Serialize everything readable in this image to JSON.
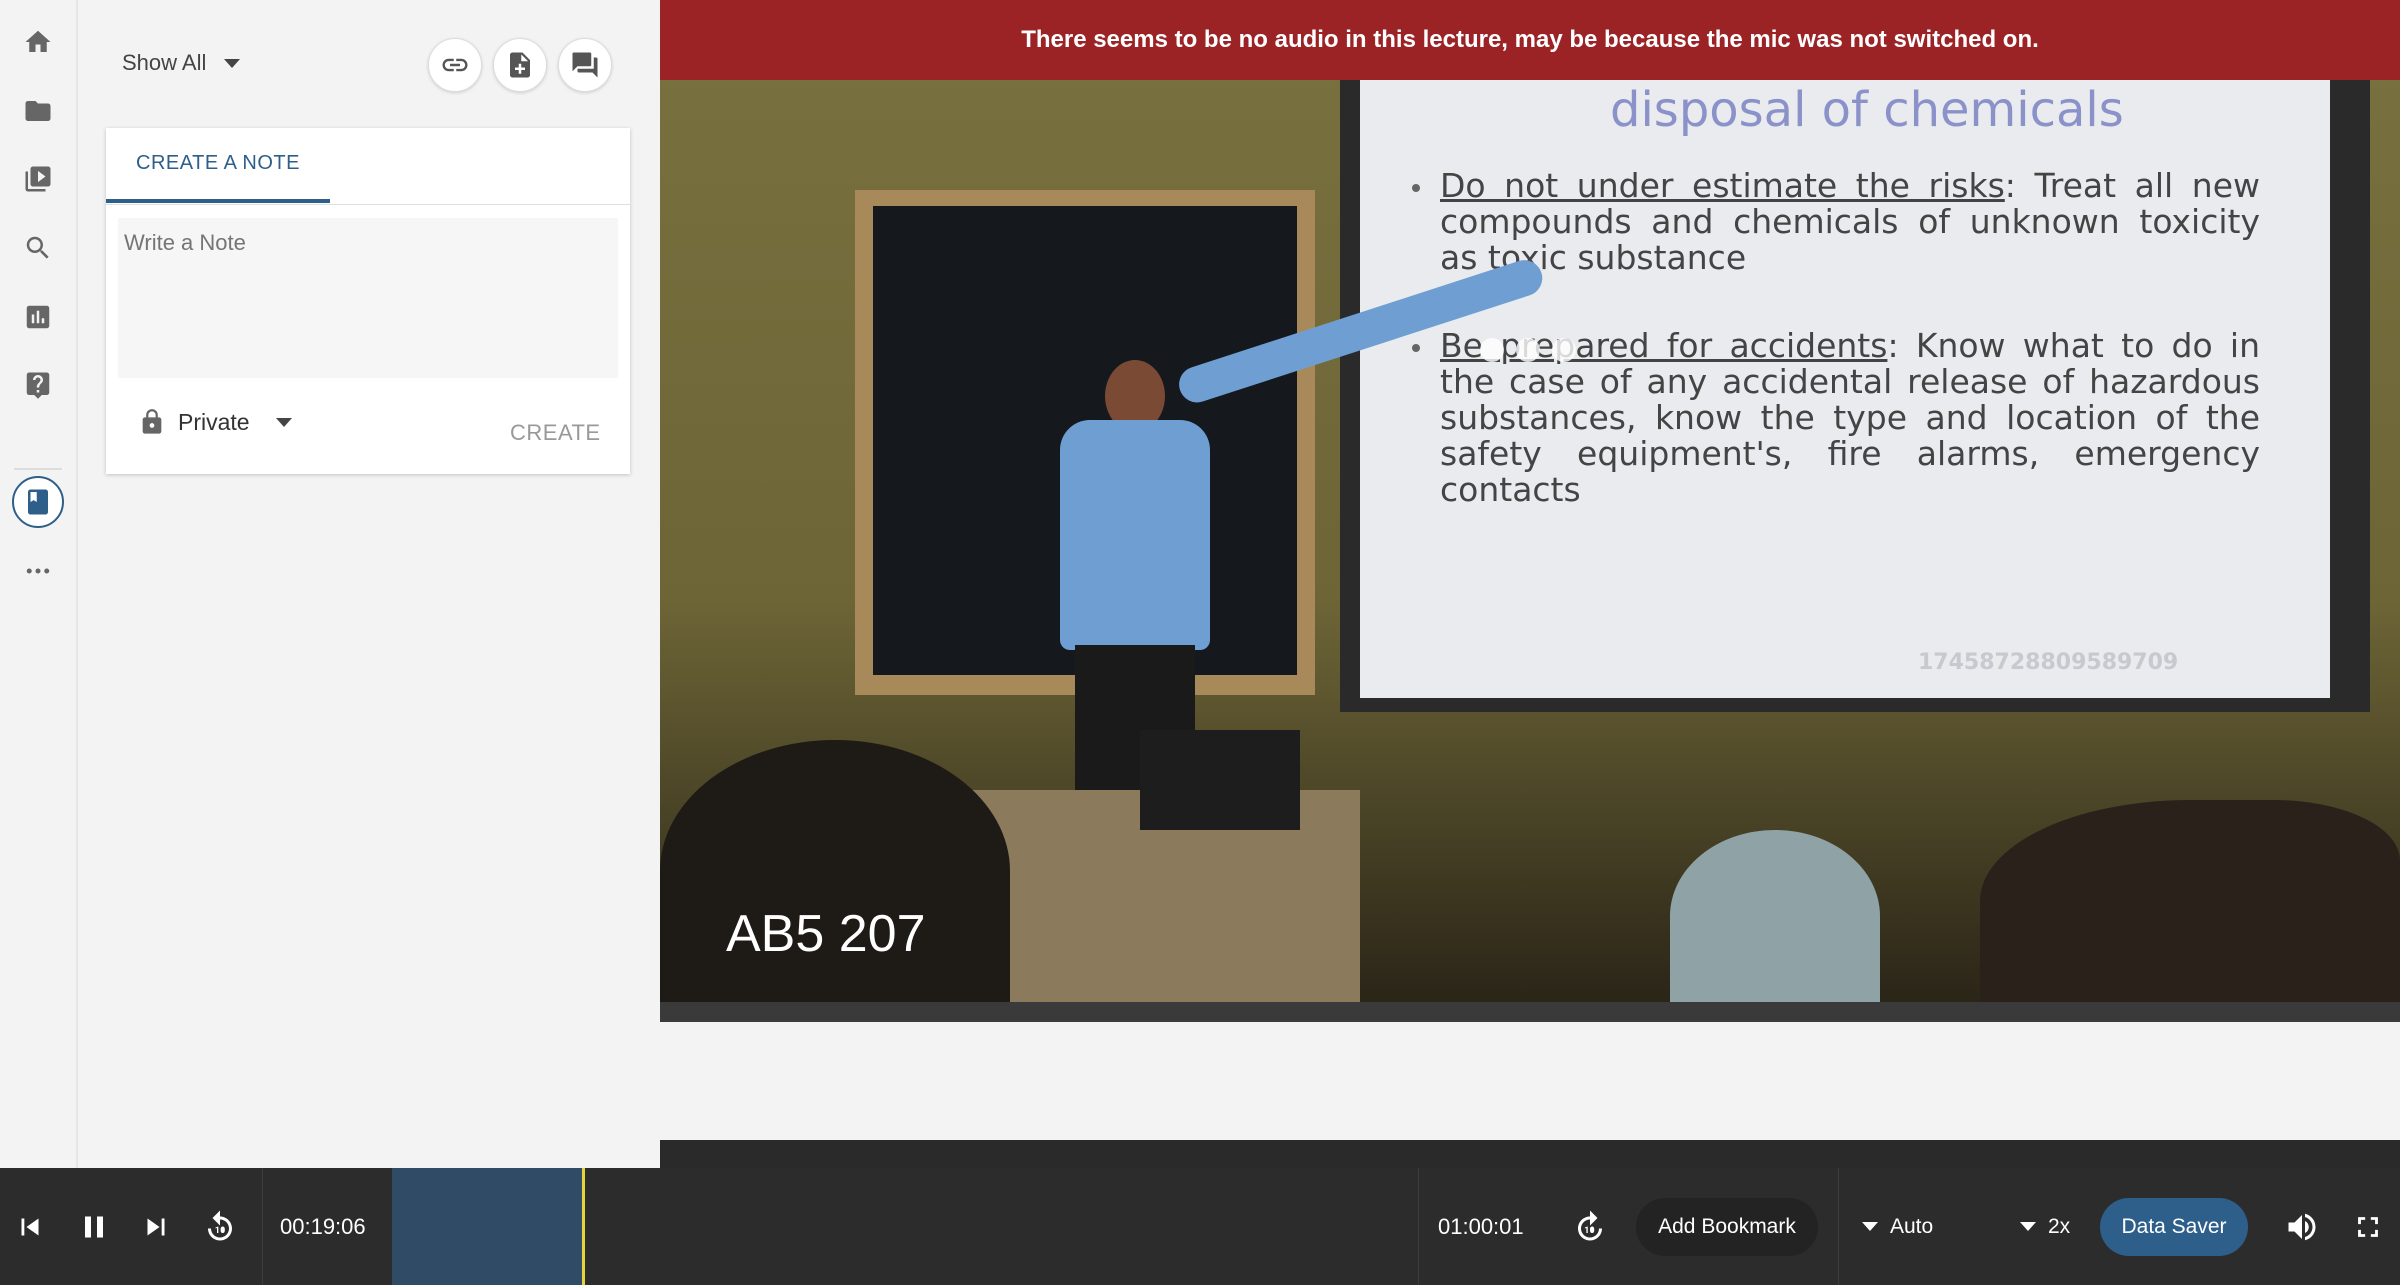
{
  "sidebar": {
    "icons": [
      "home-icon",
      "folder-icon",
      "video-library-icon",
      "search-icon",
      "analytics-icon",
      "help-icon",
      "notebook-icon",
      "more-icon"
    ]
  },
  "notes": {
    "filter_label": "Show All",
    "tab_label": "CREATE A NOTE",
    "note_placeholder": "Write a Note",
    "privacy_label": "Private",
    "create_label": "CREATE"
  },
  "banner": {
    "message": "There seems to be no audio in this lecture, may be because the mic was not switched on."
  },
  "video": {
    "room_label": "AB5 207",
    "slide": {
      "title": "disposal of chemicals",
      "bullet1_heading": "Do not under estimate the risks",
      "bullet1_text": ": Treat all new compounds and chemicals of unknown toxicity as toxic substance",
      "bullet2_heading": "Be prepared for accidents",
      "bullet2_text": ": Know what to do in the case of any accidental release of hazardous substances, know the type and location of the safety equipment's, fire alarms, emergency contacts",
      "watermark_id": "17458728809589709"
    }
  },
  "player": {
    "current_time": "00:19:06",
    "total_time": "01:00:01",
    "progress_fraction": 0.185,
    "bookmark_label": "Add Bookmark",
    "quality_label": "Auto",
    "speed_label": "2x",
    "data_saver_label": "Data Saver"
  },
  "colors": {
    "brand_blue": "#2d5f8a",
    "banner_red": "#9b2326",
    "progress_fill": "#2f4b66",
    "progress_head": "#e5d33d",
    "control_bar": "#2c2c2c"
  }
}
